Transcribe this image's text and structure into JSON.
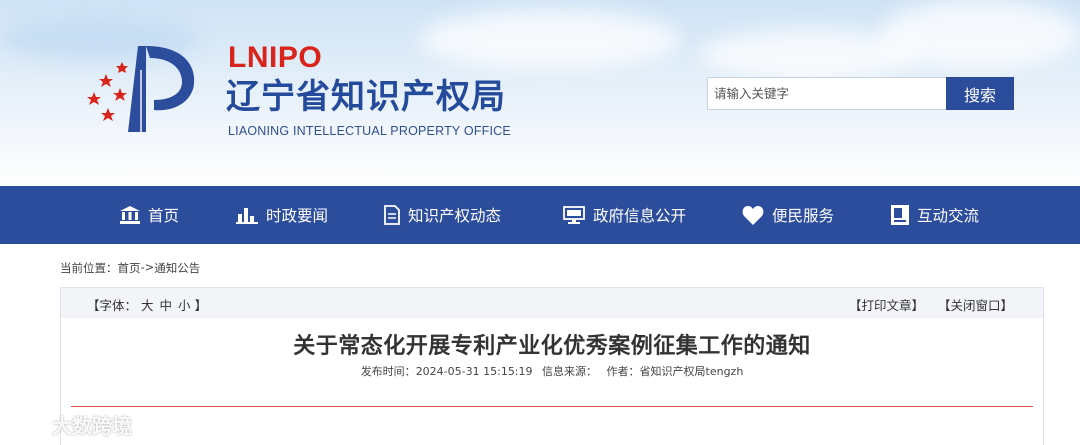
{
  "header": {
    "abbr": "LNIPO",
    "name_cn": "辽宁省知识产权局",
    "name_en": "LIAONING INTELLECTUAL PROPERTY OFFICE"
  },
  "search": {
    "placeholder": "请输入关键字",
    "button": "搜索"
  },
  "nav": {
    "items": [
      {
        "label": "首页",
        "icon": "bank-icon"
      },
      {
        "label": "时政要闻",
        "icon": "bar-chart-icon"
      },
      {
        "label": "知识产权动态",
        "icon": "document-icon"
      },
      {
        "label": "政府信息公开",
        "icon": "monitor-icon"
      },
      {
        "label": "便民服务",
        "icon": "heart-icon"
      },
      {
        "label": "互动交流",
        "icon": "book-icon"
      }
    ]
  },
  "breadcrumb": {
    "prefix": "当前位置：",
    "home": "首页",
    "sep": " -> ",
    "current": "通知公告"
  },
  "toolbar": {
    "font_label": "【字体：",
    "large": "大",
    "medium": "中",
    "small": "小",
    "font_close": "】",
    "print": "【打印文章】",
    "close": "【关闭窗口】"
  },
  "article": {
    "title": "关于常态化开展专利产业化优秀案例征集工作的通知",
    "publish_label": "发布时间：",
    "publish_time": "2024-05-31 15:15:19",
    "source_label": "信息来源：",
    "author_label": "作者：",
    "author": "省知识产权局tengzh"
  },
  "watermark": {
    "text": "大数跨境"
  },
  "colors": {
    "brand_blue": "#2c4c9c",
    "logo_red": "#d9241b",
    "divider_red": "#d9534f"
  }
}
